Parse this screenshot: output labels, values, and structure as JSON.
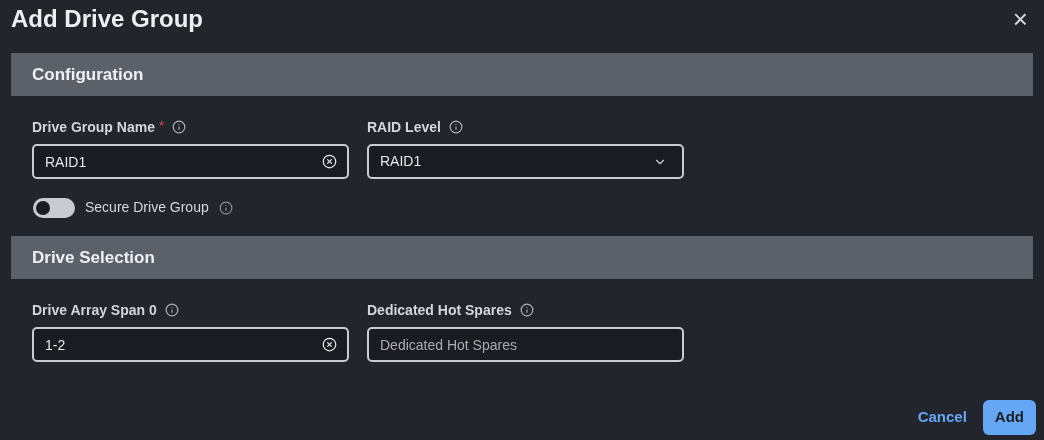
{
  "dialog": {
    "title": "Add Drive Group",
    "close": "×"
  },
  "sections": [
    {
      "title": "Configuration",
      "fields": [
        {
          "kind": "text",
          "label": "Drive Group Name",
          "required_mark": "*",
          "value": "RAID1",
          "clearable": true
        },
        {
          "kind": "select",
          "label": "RAID Level",
          "value": "RAID1"
        }
      ],
      "toggle": {
        "label": "Secure Drive Group",
        "on": false
      }
    },
    {
      "title": "Drive Selection",
      "fields": [
        {
          "kind": "text",
          "label": "Drive Array Span 0",
          "value": "1-2",
          "clearable": true
        },
        {
          "kind": "text",
          "label": "Dedicated Hot Spares",
          "placeholder": "Dedicated Hot Spares",
          "clearable": false
        }
      ]
    }
  ],
  "buttons": [
    {
      "label": "Cancel",
      "kind": "link"
    },
    {
      "label": "Add",
      "kind": "primary"
    }
  ]
}
